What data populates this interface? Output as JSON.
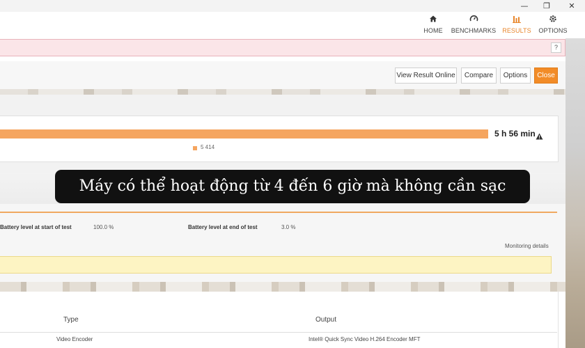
{
  "window_controls": {
    "minimize": "—",
    "restore": "❐",
    "close": "✕"
  },
  "nav": {
    "items": [
      {
        "label": "HOME",
        "icon": "home-icon",
        "active": false
      },
      {
        "label": "BENCHMARKS",
        "icon": "gauge-icon",
        "active": false
      },
      {
        "label": "RESULTS",
        "icon": "bar-chart-icon",
        "active": true
      },
      {
        "label": "OPTIONS",
        "icon": "gear-icon",
        "active": false
      }
    ],
    "accent_color": "#e8862b"
  },
  "alert": {
    "help_label": "?",
    "color": "#fbe5e8"
  },
  "actions": {
    "view_online": "View Result Online",
    "compare": "Compare",
    "options": "Options",
    "close": "Close",
    "close_color": "#f28c28"
  },
  "result": {
    "battery_life": "5 h 56 min",
    "warning_icon": "warning-triangle-icon",
    "legend_value": "5 414",
    "bar_color": "#f5a55f"
  },
  "caption": "Máy có thể hoạt động từ 4 đến 6 giờ mà không cần sạc",
  "details": {
    "start_label": "Battery level at start of test",
    "start_value": "100.0 %",
    "end_label": "Battery level at end of test",
    "end_value": "3.0 %",
    "monitoring_link": "Monitoring details"
  },
  "table": {
    "headers": [
      "Type",
      "Output"
    ],
    "rows": [
      {
        "type": "Video Encoder",
        "output": "Intel® Quick Sync Video H.264 Encoder MFT"
      }
    ]
  }
}
